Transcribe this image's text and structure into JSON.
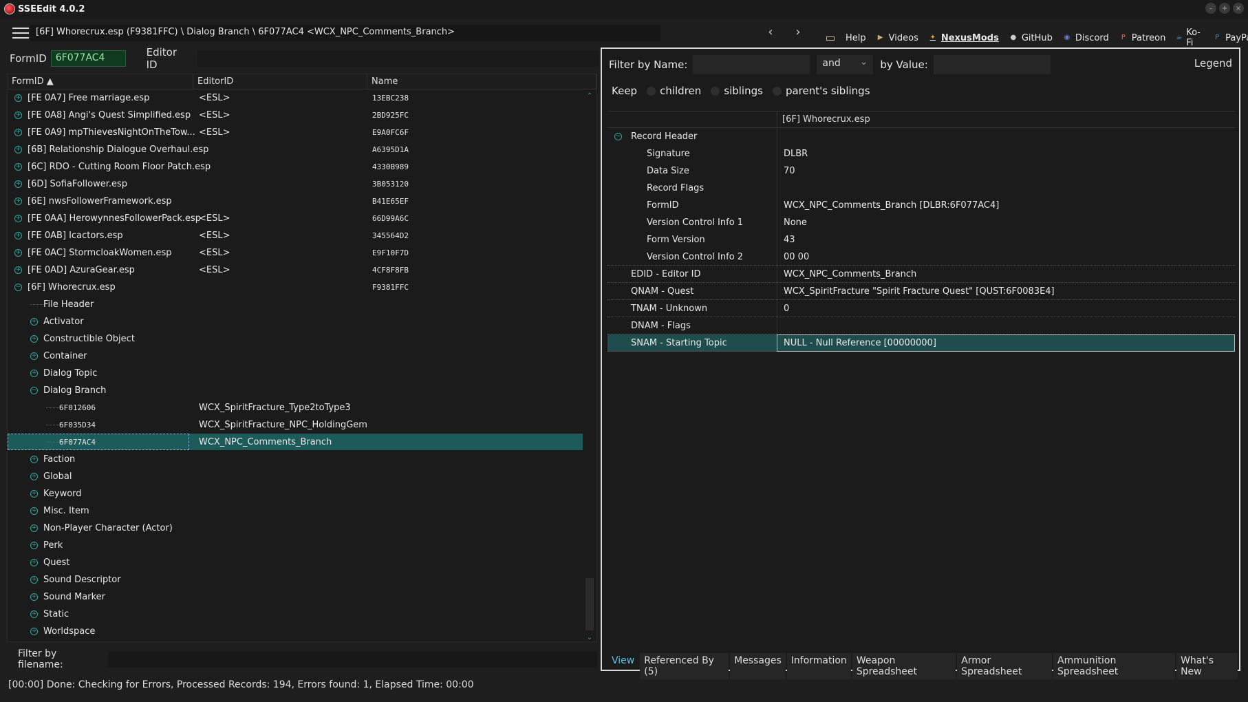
{
  "window": {
    "title": "SSEEdit 4.0.2"
  },
  "toolbar": {
    "path": "[6F] Whorecrux.esp (F9381FFC) \\ Dialog Branch \\ 6F077AC4 <WCX_NPC_Comments_Branch>",
    "back": "‹",
    "forward": "›",
    "links": [
      {
        "label": "Help",
        "icon": "book-icon"
      },
      {
        "label": "Videos",
        "icon": "videos-icon"
      },
      {
        "label": "NexusMods",
        "icon": "nexusmods-icon"
      },
      {
        "label": "GitHub",
        "icon": "github-icon"
      },
      {
        "label": "Discord",
        "icon": "discord-icon"
      },
      {
        "label": "Patreon",
        "icon": "patreon-icon"
      },
      {
        "label": "Ko-Fi",
        "icon": "kofi-icon"
      },
      {
        "label": "PayPal",
        "icon": "paypal-icon"
      }
    ]
  },
  "left": {
    "formid_label": "FormID",
    "formid_value": "6F077AC4",
    "editorid_label": "Editor ID",
    "columns": [
      "FormID",
      "EditorID",
      "Name"
    ],
    "rows": [
      {
        "c1": "[FE 0A7] Free marriage.esp",
        "c2": "<ESL>",
        "c3": "13EBC238",
        "exp": "+",
        "indent": 0
      },
      {
        "c1": "[FE 0A8] Angi's Quest Simplified.esp",
        "c2": "<ESL>",
        "c3": "2BD925FC",
        "exp": "+",
        "indent": 0
      },
      {
        "c1": "[FE 0A9] mpThievesNightOnTheTow...",
        "c2": "<ESL>",
        "c3": "E9A0FC6F",
        "exp": "+",
        "indent": 0
      },
      {
        "c1": "[6B] Relationship Dialogue Overhaul.esp",
        "c2": "",
        "c3": "A6395D1A",
        "exp": "+",
        "indent": 0
      },
      {
        "c1": "[6C] RDO - Cutting Room Floor Patch.esp",
        "c2": "",
        "c3": "4330B989",
        "exp": "+",
        "indent": 0
      },
      {
        "c1": "[6D] SofiaFollower.esp",
        "c2": "",
        "c3": "3B053120",
        "exp": "+",
        "indent": 0
      },
      {
        "c1": "[6E] nwsFollowerFramework.esp",
        "c2": "",
        "c3": "B41E65EF",
        "exp": "+",
        "indent": 0
      },
      {
        "c1": "[FE 0AA] HerowynnesFollowerPack.esp",
        "c2": "<ESL>",
        "c3": "66D99A6C",
        "exp": "+",
        "indent": 0
      },
      {
        "c1": "[FE 0AB] Icactors.esp",
        "c2": "<ESL>",
        "c3": "345564D2",
        "exp": "+",
        "indent": 0
      },
      {
        "c1": "[FE 0AC] StormcloakWomen.esp",
        "c2": "<ESL>",
        "c3": "E9F10F7D",
        "exp": "+",
        "indent": 0
      },
      {
        "c1": "[FE 0AD] AzuraGear.esp",
        "c2": "<ESL>",
        "c3": "4CF8F8FB",
        "exp": "+",
        "indent": 0
      },
      {
        "c1": "[6F] Whorecrux.esp",
        "c2": "",
        "c3": "F9381FFC",
        "exp": "−",
        "indent": 0
      },
      {
        "c1": "File Header",
        "c2": "",
        "c3": "",
        "exp": "",
        "indent": 1
      },
      {
        "c1": "Activator",
        "c2": "",
        "c3": "",
        "exp": "+",
        "indent": 1
      },
      {
        "c1": "Constructible Object",
        "c2": "",
        "c3": "",
        "exp": "+",
        "indent": 1
      },
      {
        "c1": "Container",
        "c2": "",
        "c3": "",
        "exp": "+",
        "indent": 1
      },
      {
        "c1": "Dialog Topic",
        "c2": "",
        "c3": "",
        "exp": "+",
        "indent": 1
      },
      {
        "c1": "Dialog Branch",
        "c2": "",
        "c3": "",
        "exp": "−",
        "indent": 1
      },
      {
        "c1": "6F012606",
        "c2": "WCX_SpiritFracture_Type2toType3",
        "c3": "",
        "exp": "",
        "indent": 2,
        "mono": true
      },
      {
        "c1": "6F035D34",
        "c2": "WCX_SpiritFracture_NPC_HoldingGem",
        "c3": "",
        "exp": "",
        "indent": 2,
        "mono": true
      },
      {
        "c1": "6F077AC4",
        "c2": "WCX_NPC_Comments_Branch",
        "c3": "",
        "exp": "",
        "indent": 2,
        "mono": true,
        "selected": true
      },
      {
        "c1": "Faction",
        "c2": "",
        "c3": "",
        "exp": "+",
        "indent": 1
      },
      {
        "c1": "Global",
        "c2": "",
        "c3": "",
        "exp": "+",
        "indent": 1
      },
      {
        "c1": "Keyword",
        "c2": "",
        "c3": "",
        "exp": "+",
        "indent": 1
      },
      {
        "c1": "Misc. Item",
        "c2": "",
        "c3": "",
        "exp": "+",
        "indent": 1
      },
      {
        "c1": "Non-Player Character (Actor)",
        "c2": "",
        "c3": "",
        "exp": "+",
        "indent": 1
      },
      {
        "c1": "Perk",
        "c2": "",
        "c3": "",
        "exp": "+",
        "indent": 1
      },
      {
        "c1": "Quest",
        "c2": "",
        "c3": "",
        "exp": "+",
        "indent": 1
      },
      {
        "c1": "Sound Descriptor",
        "c2": "",
        "c3": "",
        "exp": "+",
        "indent": 1
      },
      {
        "c1": "Sound Marker",
        "c2": "",
        "c3": "",
        "exp": "+",
        "indent": 1
      },
      {
        "c1": "Static",
        "c2": "",
        "c3": "",
        "exp": "+",
        "indent": 1
      },
      {
        "c1": "Worldspace",
        "c2": "",
        "c3": "",
        "exp": "+",
        "indent": 1
      }
    ],
    "filter_label": "Filter by filename:"
  },
  "right": {
    "filter_name_label": "Filter by Name:",
    "and_label": "and",
    "by_value_label": "by Value:",
    "legend_label": "Legend",
    "keep_label": "Keep",
    "keep_options": [
      "children",
      "siblings",
      "parent's siblings"
    ],
    "column_header": "[6F] Whorecrux.esp",
    "fields": [
      {
        "name": "Record Header",
        "value": "",
        "level": 0,
        "exp": "−"
      },
      {
        "name": "Signature",
        "value": "DLBR",
        "level": 1
      },
      {
        "name": "Data Size",
        "value": "70",
        "level": 1
      },
      {
        "name": "Record Flags",
        "value": "",
        "level": 1
      },
      {
        "name": "FormID",
        "value": "WCX_NPC_Comments_Branch [DLBR:6F077AC4]",
        "level": 1
      },
      {
        "name": "Version Control Info 1",
        "value": "None",
        "level": 1
      },
      {
        "name": "Form Version",
        "value": "43",
        "level": 1
      },
      {
        "name": "Version Control Info 2",
        "value": "00 00",
        "level": 1
      },
      {
        "name": "EDID - Editor ID",
        "value": "WCX_NPC_Comments_Branch",
        "level": 0
      },
      {
        "name": "QNAM - Quest",
        "value": "WCX_SpiritFracture \"Spirit Fracture Quest\" [QUST:6F0083E4]",
        "level": 0
      },
      {
        "name": "TNAM - Unknown",
        "value": "0",
        "level": 0
      },
      {
        "name": "DNAM - Flags",
        "value": "",
        "level": 0
      },
      {
        "name": "SNAM - Starting Topic",
        "value": "NULL - Null Reference [00000000]",
        "level": 0,
        "selected": true
      }
    ],
    "tabs": [
      "View",
      "Referenced By (5)",
      "Messages",
      "Information",
      "Weapon Spreadsheet",
      "Armor Spreadsheet",
      "Ammunition Spreadsheet",
      "What's New"
    ],
    "active_tab": "View"
  },
  "status": "[00:00] Done: Checking for Errors, Processed Records: 194, Errors found: 1, Elapsed Time: 00:00"
}
